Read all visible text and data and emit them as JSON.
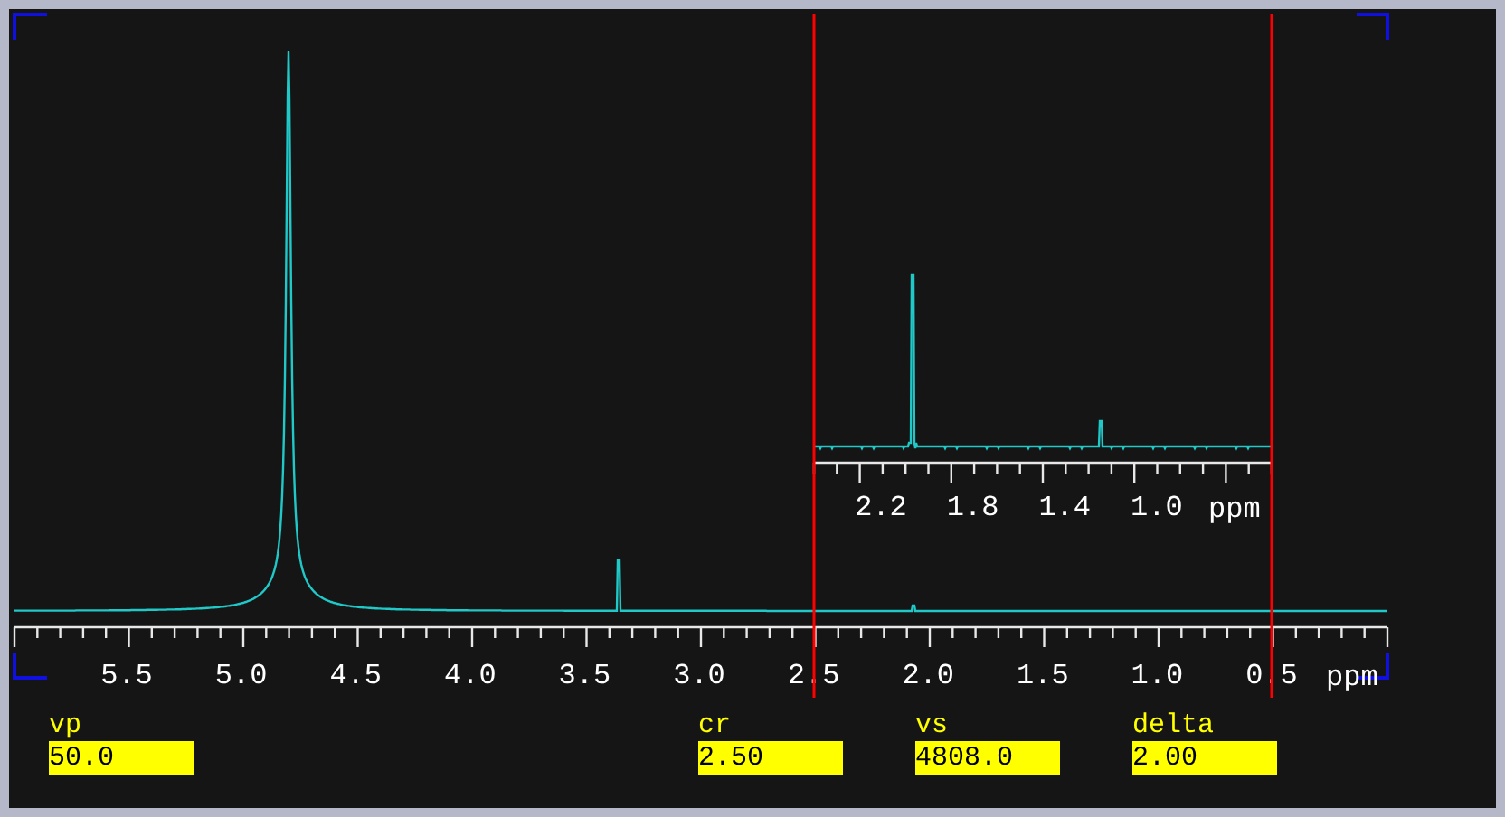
{
  "spectrum": {
    "axis_labels": [
      "5.5",
      "5.0",
      "4.5",
      "4.0",
      "3.5",
      "3.0",
      "2.5",
      "2.0",
      "1.5",
      "1.0",
      "0.5"
    ],
    "axis_unit": "ppm"
  },
  "inset": {
    "axis_labels": [
      "2.2",
      "1.8",
      "1.4",
      "1.0"
    ],
    "axis_unit": "ppm"
  },
  "parameters": [
    {
      "label": "vp",
      "value": "50.0"
    },
    {
      "label": "cr",
      "value": "2.50"
    },
    {
      "label": "vs",
      "value": "4808.0"
    },
    {
      "label": "delta",
      "value": "2.00"
    }
  ]
}
